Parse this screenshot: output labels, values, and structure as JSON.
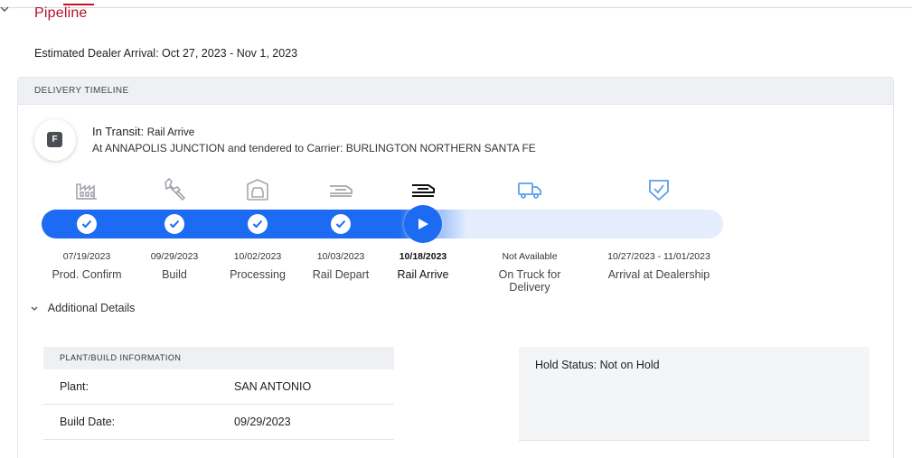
{
  "section": {
    "title": "Pipeline",
    "estimated_arrival": "Estimated Dealer Arrival: Oct 27, 2023 - Nov 1, 2023"
  },
  "timeline": {
    "header": "DELIVERY TIMELINE",
    "status_icon_letter": "F",
    "status_prefix": "In Transit:",
    "status_value": "Rail Arrive",
    "status_detail": "At ANNAPOLIS JUNCTION and tendered to Carrier: BURLINGTON NORTHERN SANTA FE",
    "progress": {
      "completed_steps": 4,
      "current_step": 5,
      "total_steps": 7
    },
    "steps": [
      {
        "date": "07/19/2023",
        "label": "Prod. Confirm",
        "icon": "factory-icon",
        "state": "complete"
      },
      {
        "date": "09/29/2023",
        "label": "Build",
        "icon": "wrench-icon",
        "state": "complete"
      },
      {
        "date": "10/02/2023",
        "label": "Processing",
        "icon": "car-wash-icon",
        "state": "complete"
      },
      {
        "date": "10/03/2023",
        "label": "Rail Depart",
        "icon": "train-icon",
        "state": "complete"
      },
      {
        "date": "10/18/2023",
        "label": "Rail Arrive",
        "icon": "train-icon",
        "state": "current"
      },
      {
        "date": "Not Available",
        "label": "On Truck for Delivery",
        "icon": "truck-icon",
        "state": "pending"
      },
      {
        "date": "10/27/2023 - 11/01/2023",
        "label": "Arrival at Dealership",
        "icon": "shield-check-icon",
        "state": "pending"
      }
    ]
  },
  "additional_details": {
    "toggle_label": "Additional Details",
    "plant_info": {
      "header": "PLANT/BUILD INFORMATION",
      "rows": [
        {
          "key": "Plant:",
          "value": "SAN ANTONIO"
        },
        {
          "key": "Build Date:",
          "value": "09/29/2023"
        }
      ]
    },
    "hold_status": "Hold Status: Not on Hold"
  },
  "colors": {
    "brand_red": "#b5102b",
    "progress_blue": "#1c6bf2",
    "track_light": "#e5edfd",
    "pending_icon": "#5aa0ea",
    "done_icon": "#9aa0a6"
  }
}
